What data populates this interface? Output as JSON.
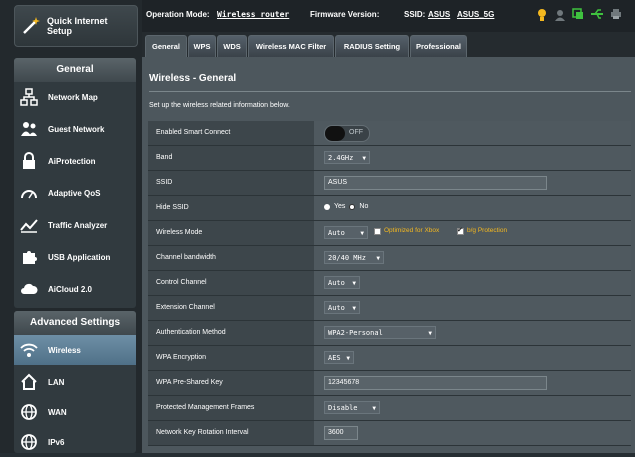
{
  "sidebar": {
    "quick_setup": "Quick Internet\nSetup",
    "general_head": "General",
    "general_items": [
      {
        "label": "Network Map",
        "icon": "network-map-icon"
      },
      {
        "label": "Guest Network",
        "icon": "guest-network-icon"
      },
      {
        "label": "AiProtection",
        "icon": "lock-icon"
      },
      {
        "label": "Adaptive QoS",
        "icon": "gauge-icon"
      },
      {
        "label": "Traffic Analyzer",
        "icon": "chart-icon"
      },
      {
        "label": "USB Application",
        "icon": "puzzle-icon"
      },
      {
        "label": "AiCloud 2.0",
        "icon": "cloud-icon"
      }
    ],
    "advanced_head": "Advanced Settings",
    "advanced_items": [
      {
        "label": "Wireless",
        "icon": "wifi-icon",
        "active": true
      },
      {
        "label": "LAN",
        "icon": "home-icon"
      },
      {
        "label": "WAN",
        "icon": "globe-icon"
      },
      {
        "label": "IPv6",
        "icon": "ipv6-globe-icon"
      }
    ]
  },
  "topbar": {
    "op_mode_label": "Operation Mode:",
    "op_mode_value": "Wireless router",
    "firmware_label": "Firmware Version:",
    "ssid_label": "SSID:",
    "ssid_1": "ASUS",
    "ssid_2": "ASUS_5G"
  },
  "tabs": [
    "General",
    "WPS",
    "WDS",
    "Wireless MAC Filter",
    "RADIUS Setting",
    "Professional"
  ],
  "page": {
    "title": "Wireless - General",
    "description": "Set up the wireless related information below."
  },
  "form": {
    "smart_connect": {
      "label": "Enabled Smart Connect",
      "value": "OFF"
    },
    "band": {
      "label": "Band",
      "value": "2.4GHz"
    },
    "ssid": {
      "label": "SSID",
      "value": "ASUS"
    },
    "hide_ssid": {
      "label": "Hide SSID",
      "yes": "Yes",
      "no": "No",
      "selected": "Yes"
    },
    "wireless_mode": {
      "label": "Wireless Mode",
      "value": "Auto",
      "opt_xbox": "Optimized for Xbox",
      "opt_bg": "b/g Protection",
      "xbox_checked": false,
      "bg_checked": true
    },
    "channel_bandwidth": {
      "label": "Channel bandwidth",
      "value": "20/40 MHz"
    },
    "control_channel": {
      "label": "Control Channel",
      "value": "Auto"
    },
    "extension_channel": {
      "label": "Extension Channel",
      "value": "Auto"
    },
    "auth_method": {
      "label": "Authentication Method",
      "value": "WPA2-Personal"
    },
    "wpa_encryption": {
      "label": "WPA Encryption",
      "value": "AES"
    },
    "wpa_psk": {
      "label": "WPA Pre-Shared Key",
      "value": "12345678"
    },
    "pmf": {
      "label": "Protected Management Frames",
      "value": "Disable"
    },
    "key_rotation": {
      "label": "Network Key Rotation Interval",
      "value": "3600"
    }
  },
  "colors": {
    "accent": "#f4b81f",
    "active_nav": "#5f7f97",
    "background": "#262e33"
  }
}
